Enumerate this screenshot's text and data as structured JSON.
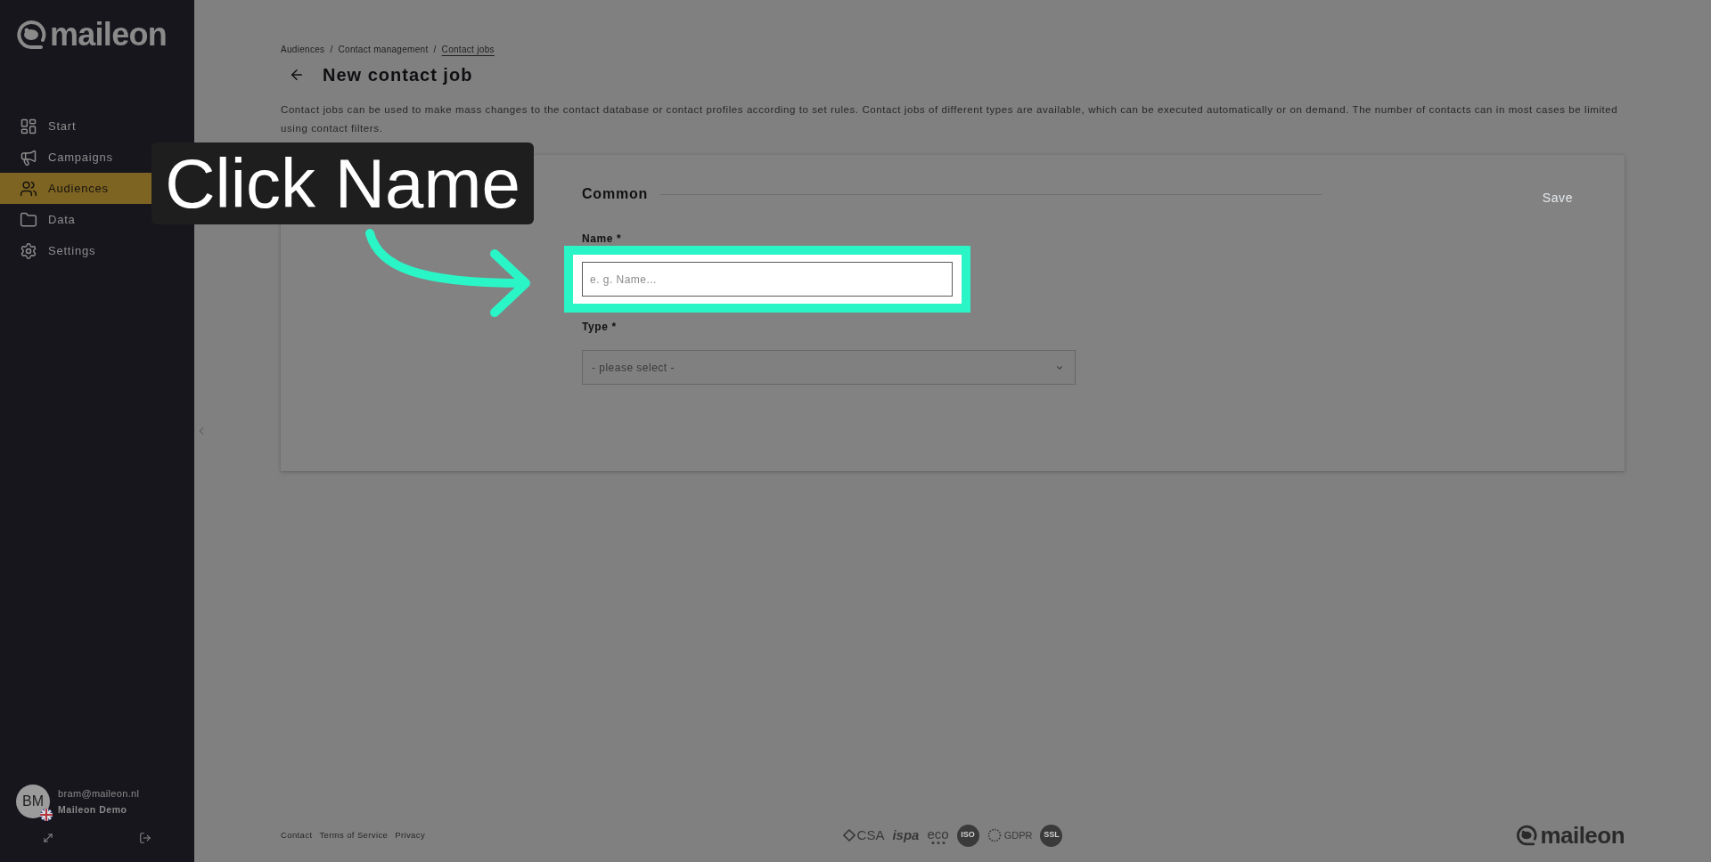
{
  "sidebar": {
    "logo": "maileon",
    "items": [
      {
        "label": "Start",
        "selected": false
      },
      {
        "label": "Campaigns",
        "selected": false
      },
      {
        "label": "Audiences",
        "selected": true
      },
      {
        "label": "Data",
        "selected": false
      },
      {
        "label": "Settings",
        "selected": false
      }
    ]
  },
  "user": {
    "initials": "BM",
    "email": "bram@maileon.nl",
    "account": "Maileon Demo"
  },
  "breadcrumb": {
    "separator": "/",
    "items": [
      {
        "label": "Audiences",
        "current": false
      },
      {
        "label": "Contact management",
        "current": false
      },
      {
        "label": "Contact jobs",
        "current": true
      }
    ]
  },
  "page": {
    "title": "New contact job",
    "description": "Contact jobs can be used to make mass changes to the contact database or contact profiles according to set rules. Contact jobs of different types are available, which can be executed automatically or on demand. The number of contacts can in most cases be limited using contact filters."
  },
  "form": {
    "section": "Common",
    "save": {
      "label": "Save",
      "disabled": true
    },
    "fields": [
      {
        "kind": "text",
        "label": "Name *",
        "placeholder": "e. g. Name...",
        "highlighted": true
      },
      {
        "kind": "select",
        "label": "Type *",
        "placeholder": "- please select -",
        "highlighted": false
      }
    ]
  },
  "footer": {
    "links": [
      "Contact",
      "Terms of Service",
      "Privacy"
    ],
    "badges": [
      {
        "kind": "icon-text",
        "label": "CSA"
      },
      {
        "kind": "italic",
        "label": "ispa"
      },
      {
        "kind": "dots",
        "label": "eco"
      },
      {
        "kind": "seal",
        "label": "ISO"
      },
      {
        "kind": "ring",
        "label": "GDPR"
      },
      {
        "kind": "seal",
        "label": "SSL"
      }
    ],
    "logo": "maileon"
  },
  "callout": {
    "text": "Click Name"
  }
}
